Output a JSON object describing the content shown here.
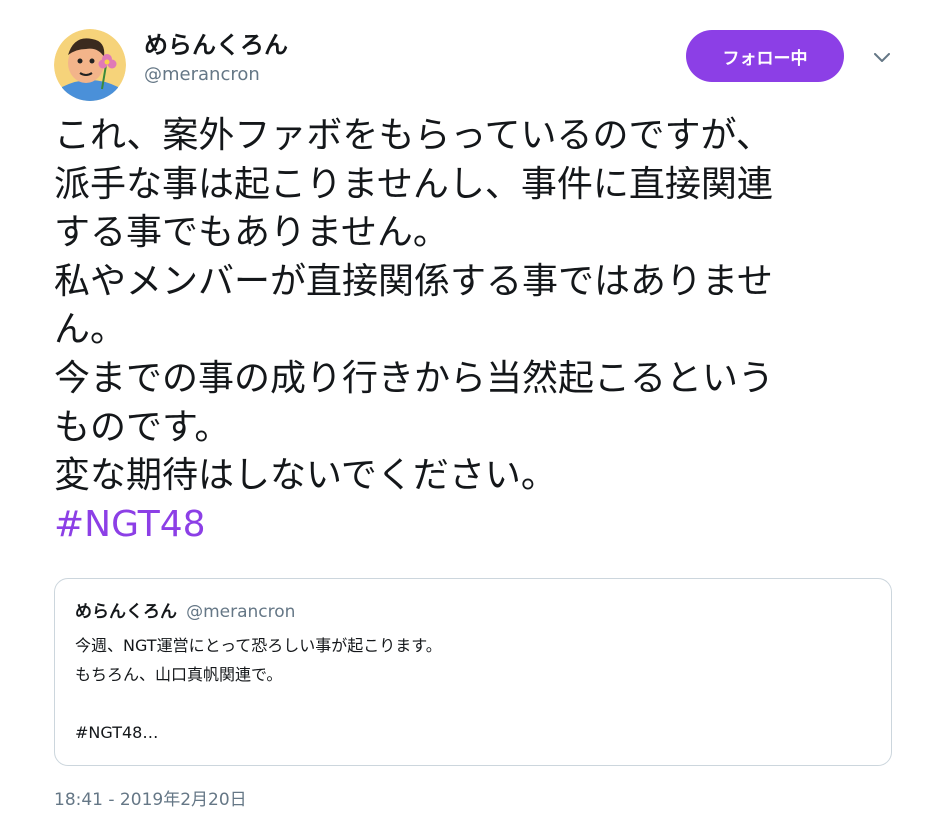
{
  "author": {
    "display_name": "めらんくろん",
    "handle": "@merancron"
  },
  "follow_button": {
    "label": "フォロー中"
  },
  "menu": {
    "icon": "chevron-down-icon"
  },
  "tweet": {
    "lines": [
      "これ、案外ファボをもらっているのですが、",
      "派手な事は起こりませんし、事件に直接関連",
      "する事でもありません。",
      "私やメンバーが直接関係する事ではありませ",
      "ん。",
      "今までの事の成り行きから当然起こるという",
      "ものです。",
      "変な期待はしないでください。"
    ],
    "hashtag": "#NGT48"
  },
  "quoted_tweet": {
    "display_name": "めらんくろん",
    "handle": "@merancron",
    "lines": [
      "今週、NGT運営にとって恐ろしい事が起こります。",
      "もちろん、山口真帆関連で。",
      "",
      "#NGT48…"
    ]
  },
  "timestamp": "18:41 - 2019年2月20日",
  "colors": {
    "accent": "#8c3fe6",
    "secondary_text": "#657786",
    "border": "#ccd6dd",
    "text": "#14171a"
  }
}
